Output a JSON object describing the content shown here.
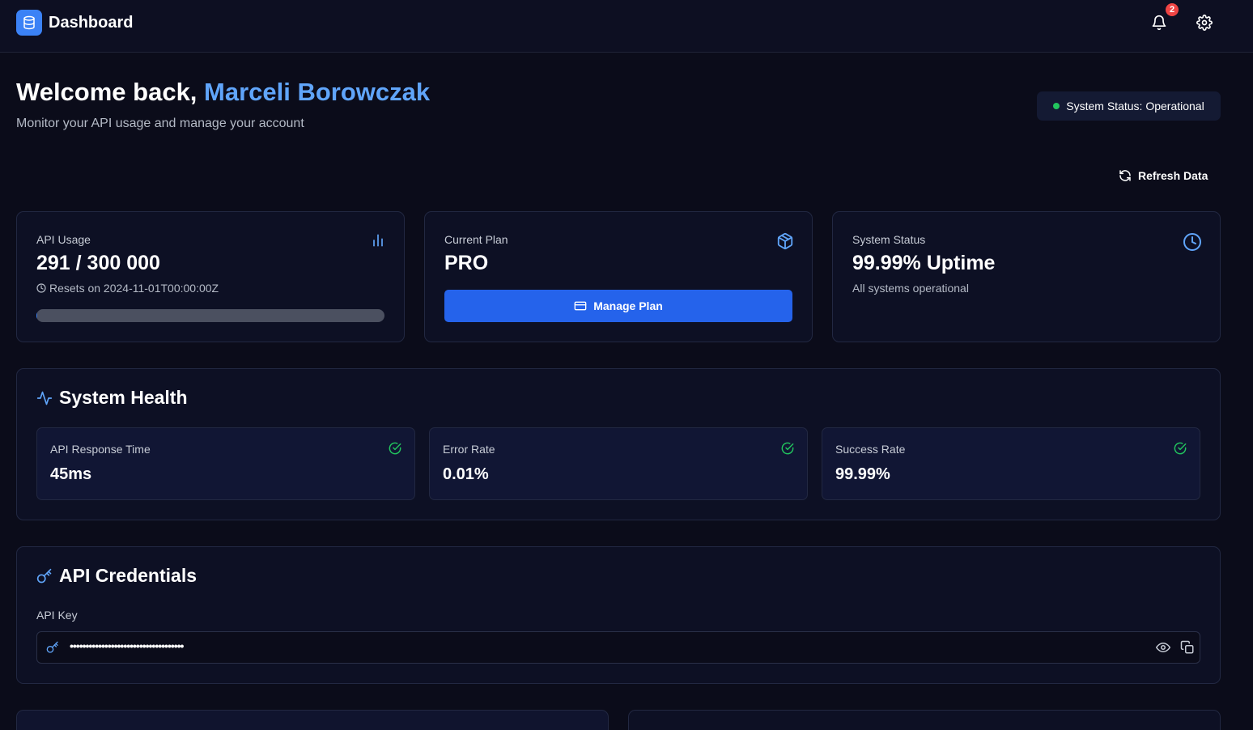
{
  "header": {
    "title": "Dashboard",
    "notification_count": "2"
  },
  "welcome": {
    "greeting": "Welcome back, ",
    "user_name": "Marceli Borowczak",
    "subtitle": "Monitor your API usage and manage your account"
  },
  "status_pill": {
    "label": "System Status: Operational",
    "dot_color": "#22c55e"
  },
  "refresh": {
    "label": "Refresh Data"
  },
  "cards": {
    "usage": {
      "label": "API Usage",
      "value": "291 / 300 000",
      "reset": "Resets on 2024-11-01T00:00:00Z",
      "used": 291,
      "limit": 300000
    },
    "plan": {
      "label": "Current Plan",
      "value": "PRO",
      "button_label": "Manage Plan"
    },
    "status": {
      "label": "System Status",
      "value": "99.99% Uptime",
      "note": "All systems operational"
    }
  },
  "health": {
    "title": "System Health",
    "metrics": [
      {
        "label": "API Response Time",
        "value": "45ms"
      },
      {
        "label": "Error Rate",
        "value": "0.01%"
      },
      {
        "label": "Success Rate",
        "value": "99.99%"
      }
    ]
  },
  "credentials": {
    "title": "API Credentials",
    "key_label": "API Key",
    "key_masked": "••••••••••••••••••••••••••••••••••••"
  },
  "colors": {
    "accent": "#3b82f6",
    "button": "#2563eb",
    "success": "#22c55e",
    "danger": "#ef4444"
  }
}
